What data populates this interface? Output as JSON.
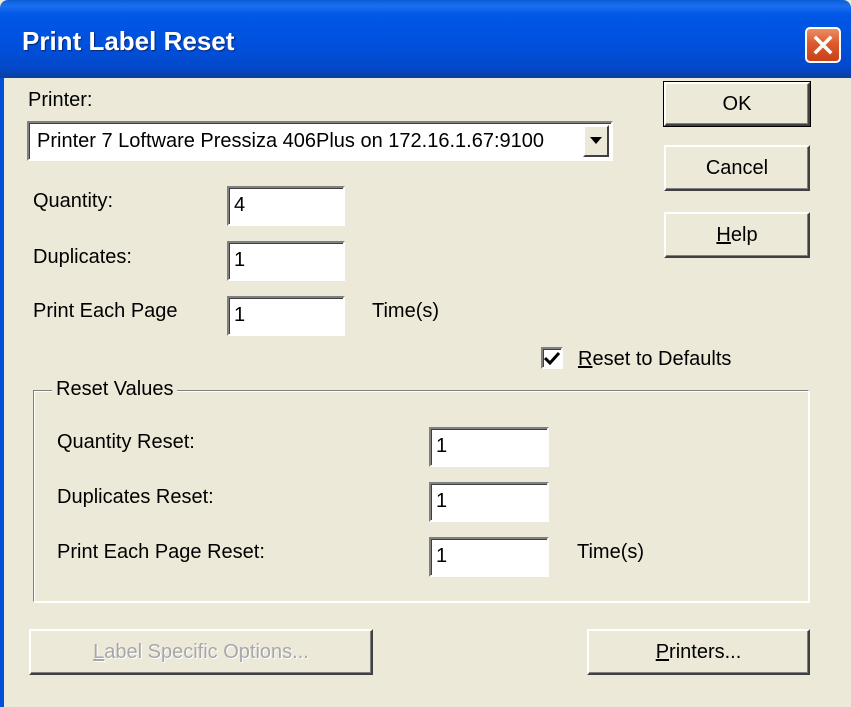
{
  "window": {
    "title": "Print Label Reset",
    "close_icon": "close-x-icon"
  },
  "printer": {
    "label": "Printer:",
    "selected": "Printer 7  Loftware Pressiza 406Plus on 172.16.1.67:9100",
    "dropdown_icon": "chevron-down-icon"
  },
  "quantity": {
    "label": "Quantity:",
    "value": "4"
  },
  "duplicates": {
    "label": "Duplicates:",
    "value": "1"
  },
  "print_each_page": {
    "label": "Print Each Page",
    "value": "1",
    "unit": "Time(s)"
  },
  "reset_to_defaults": {
    "label_prefix": "R",
    "label_rest": "eset to Defaults",
    "checked": true
  },
  "reset_values": {
    "legend": "Reset Values",
    "quantity_reset": {
      "label": "Quantity Reset:",
      "value": "1"
    },
    "duplicates_reset": {
      "label": "Duplicates Reset:",
      "value": "1"
    },
    "print_each_page_reset": {
      "label": "Print Each Page Reset:",
      "value": "1",
      "unit": "Time(s)"
    }
  },
  "buttons": {
    "ok": "OK",
    "cancel": "Cancel",
    "help_prefix": "H",
    "help_rest": "elp",
    "label_specific_prefix": "L",
    "label_specific_rest": "abel Specific Options...",
    "printers_prefix": "P",
    "printers_rest": "rinters..."
  },
  "colors": {
    "titlebar": "#0050dc",
    "dialog_bg": "#ece9d8",
    "close_button": "#de5a2c"
  }
}
